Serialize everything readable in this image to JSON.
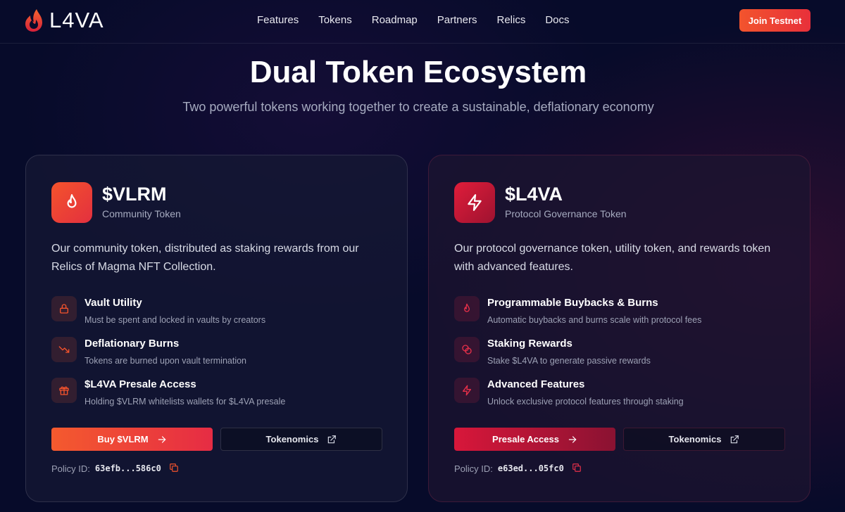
{
  "header": {
    "logo_text": "L4VA",
    "nav": [
      "Features",
      "Tokens",
      "Roadmap",
      "Partners",
      "Relics",
      "Docs"
    ],
    "cta_label": "Join Testnet"
  },
  "hero": {
    "title": "Dual Token Ecosystem",
    "subtitle": "Two powerful tokens working together to create a sustainable, deflationary economy"
  },
  "cards": [
    {
      "token_name": "$VLRM",
      "token_subtitle": "Community Token",
      "icon": "flame-icon",
      "description": "Our community token, distributed as staking rewards from our Relics of Magma NFT Collection.",
      "features": [
        {
          "icon": "lock-icon",
          "title": "Vault Utility",
          "desc": "Must be spent and locked in vaults by creators"
        },
        {
          "icon": "trending-down-icon",
          "title": "Deflationary Burns",
          "desc": "Tokens are burned upon vault termination"
        },
        {
          "icon": "gift-icon",
          "title": "$L4VA Presale Access",
          "desc": "Holding $VLRM whitelists wallets for $L4VA presale"
        }
      ],
      "primary_button": "Buy $VLRM",
      "secondary_button": "Tokenomics",
      "policy_label": "Policy ID:",
      "policy_id": "63efb...586c0"
    },
    {
      "token_name": "$L4VA",
      "token_subtitle": "Protocol Governance Token",
      "icon": "lightning-icon",
      "description": "Our protocol governance token, utility token, and rewards token with advanced features.",
      "features": [
        {
          "icon": "flame-icon",
          "title": "Programmable Buybacks & Burns",
          "desc": "Automatic buybacks and burns scale with protocol fees"
        },
        {
          "icon": "coins-icon",
          "title": "Staking Rewards",
          "desc": "Stake $L4VA to generate passive rewards"
        },
        {
          "icon": "lightning-icon",
          "title": "Advanced Features",
          "desc": "Unlock exclusive protocol features through staking"
        }
      ],
      "primary_button": "Presale Access",
      "secondary_button": "Tokenomics",
      "policy_label": "Policy ID:",
      "policy_id": "e63ed...05fc0"
    }
  ],
  "colors": {
    "background": "#070b2a",
    "accent_orange": "#f4532c",
    "accent_red": "#e01d3a"
  }
}
